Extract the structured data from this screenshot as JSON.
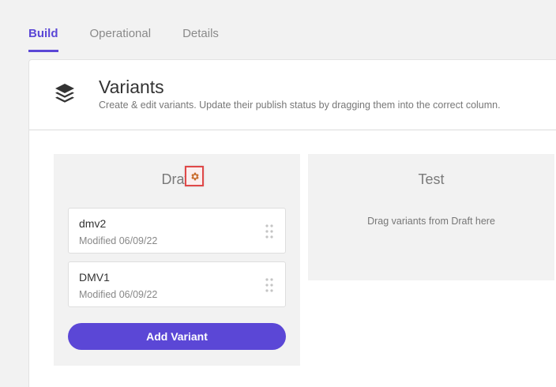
{
  "tabs": [
    {
      "label": "Build",
      "active": true
    },
    {
      "label": "Operational",
      "active": false
    },
    {
      "label": "Details",
      "active": false
    }
  ],
  "header": {
    "icon": "layers-icon",
    "title": "Variants",
    "subtitle": "Create & edit variants. Update their publish status by dragging them into the correct column."
  },
  "columns": {
    "draft": {
      "title": "Draft",
      "settings_icon": "gear-icon",
      "variants": [
        {
          "name": "dmv2",
          "modified": "Modified 06/09/22"
        },
        {
          "name": "DMV1",
          "modified": "Modified 06/09/22"
        }
      ],
      "add_button_label": "Add Variant"
    },
    "test": {
      "title": "Test",
      "empty_hint": "Drag variants from Draft here"
    }
  },
  "colors": {
    "accent": "#5b47d6",
    "gear": "#c86a2a",
    "highlight": "#e04848"
  }
}
